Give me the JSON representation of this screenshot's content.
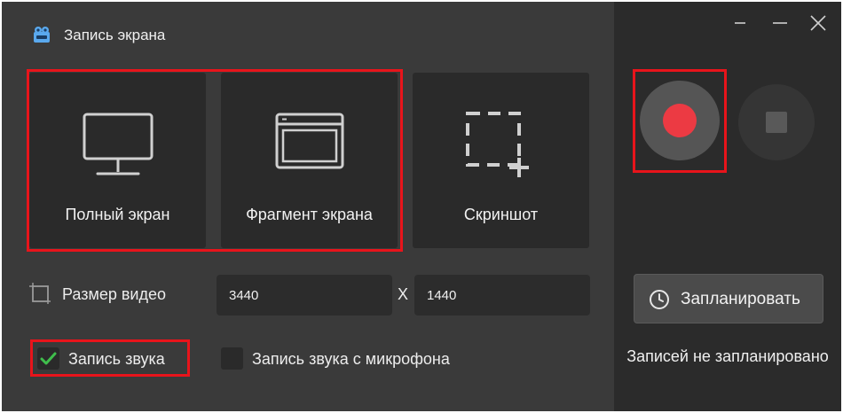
{
  "app": {
    "title": "Запись экрана",
    "icon": "app-logo-icon"
  },
  "modes": [
    {
      "label": "Полный экран",
      "icon": "monitor-icon"
    },
    {
      "label": "Фрагмент экрана",
      "icon": "window-fragment-icon"
    },
    {
      "label": "Скриншот",
      "icon": "screenshot-selection-icon"
    }
  ],
  "video_size": {
    "label": "Размер видео",
    "width": "3440",
    "separator": "X",
    "height": "1440",
    "icon": "resize-icon"
  },
  "checkboxes": {
    "audio": {
      "label": "Запись звука",
      "checked": true
    },
    "mic": {
      "label": "Запись звука с микрофона",
      "checked": false
    }
  },
  "controls": {
    "record": "record-icon",
    "stop": "stop-icon"
  },
  "schedule": {
    "button_label": "Запланировать",
    "status": "Записей не запланировано",
    "icon": "clock-icon"
  },
  "window_controls": [
    "minimize-icon",
    "maximize-icon",
    "close-icon"
  ],
  "colors": {
    "highlight": "#e8141b",
    "record": "#ec3a43",
    "check": "#3fbe4c",
    "panel": "#3a3a3a",
    "sidebar": "#2b2b2b"
  }
}
